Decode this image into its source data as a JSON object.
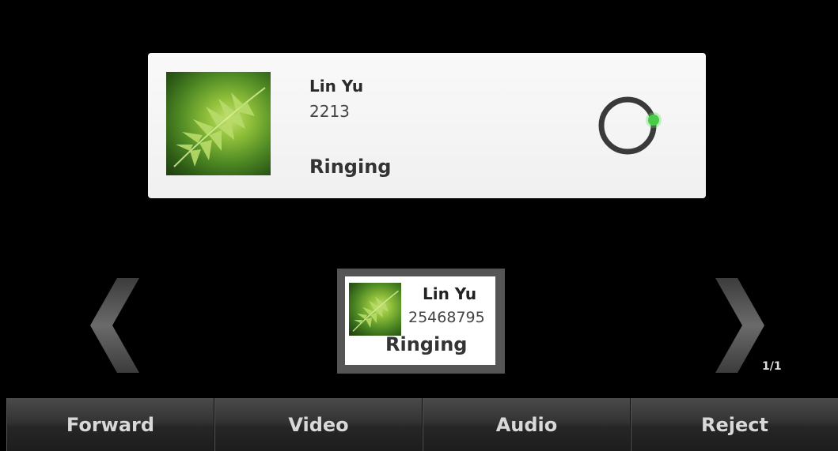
{
  "main_call": {
    "name": "Lin Yu",
    "number": "2213",
    "status": "Ringing"
  },
  "thumbnail_call": {
    "name": "Lin Yu",
    "number": "25468795",
    "status": "Ringing"
  },
  "page_indicator": "1/1",
  "softkeys": [
    {
      "label": "Forward"
    },
    {
      "label": "Video"
    },
    {
      "label": "Audio"
    },
    {
      "label": "Reject"
    }
  ],
  "colors": {
    "spinner_accent": "#3ec43e",
    "background": "#000000",
    "card": "#f5f5f5"
  },
  "icons": {
    "contact_photo": "fern-leaf-photo",
    "progress": "ringing-spinner-icon",
    "previous": "chevron-left-icon",
    "next": "chevron-right-icon"
  }
}
